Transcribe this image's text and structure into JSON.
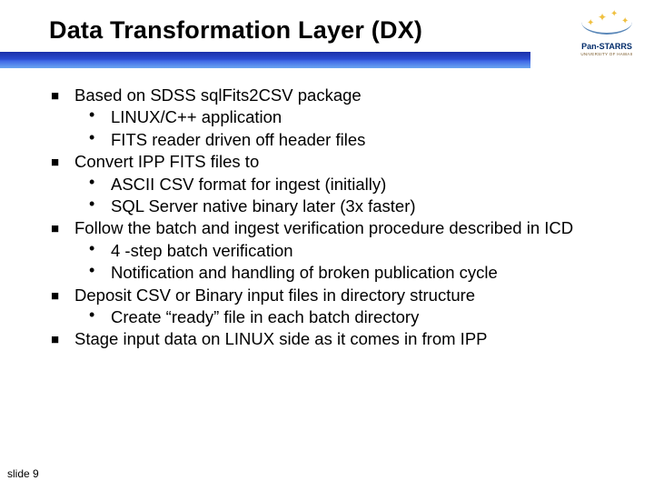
{
  "title": "Data Transformation Layer (DX)",
  "logo": {
    "brand": "Pan-STARRS",
    "sub": "UNIVERSITY OF HAWAII"
  },
  "bullets": [
    {
      "level": 1,
      "text": "Based on SDSS sqlFits2CSV package"
    },
    {
      "level": 2,
      "text": "LINUX/C++ application"
    },
    {
      "level": 2,
      "text": "FITS reader driven off header files"
    },
    {
      "level": 1,
      "text": "Convert IPP FITS files to"
    },
    {
      "level": 2,
      "text": "ASCII CSV format for ingest (initially)"
    },
    {
      "level": 2,
      "text": "SQL Server native binary later (3x faster)"
    },
    {
      "level": 1,
      "text": "Follow the batch and ingest verification procedure described in ICD"
    },
    {
      "level": 2,
      "text": "4 -step batch verification"
    },
    {
      "level": 2,
      "text": "Notification and handling of broken publication cycle"
    },
    {
      "level": 1,
      "text": "Deposit CSV or Binary input files in directory structure"
    },
    {
      "level": 2,
      "text": "Create “ready” file in each batch directory"
    },
    {
      "level": 1,
      "text": "Stage input data on LINUX side as it comes in from IPP"
    }
  ],
  "footer": "slide 9"
}
